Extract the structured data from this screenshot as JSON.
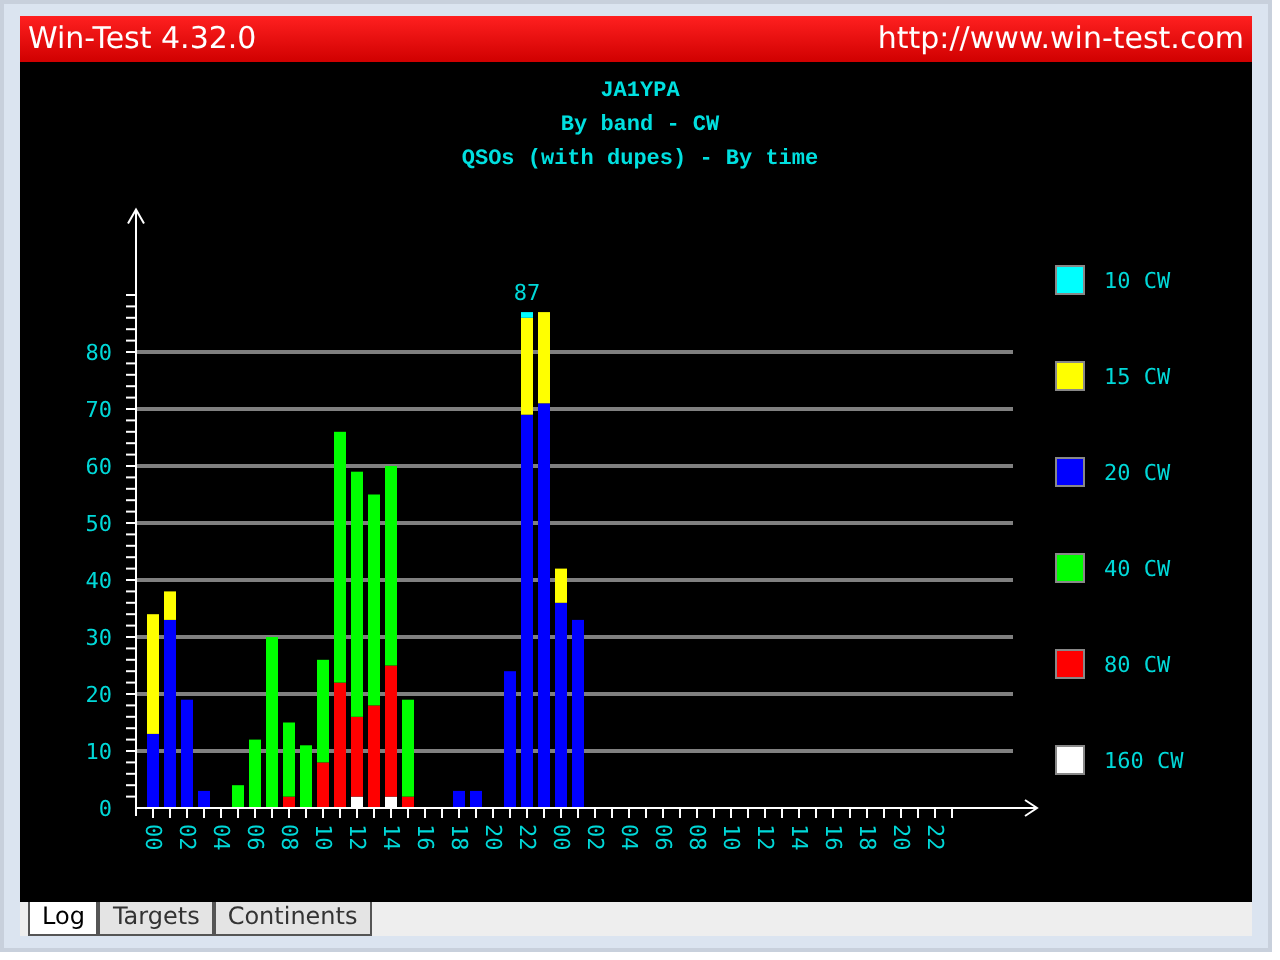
{
  "window": {
    "title": "Win-Test 4.32.0",
    "url": "http://www.win-test.com"
  },
  "chart": {
    "chart_data": {
      "type": "bar",
      "stacked": true,
      "title": [
        "JA1YPA",
        "By band - CW",
        "QSOs (with dupes) - By time"
      ],
      "x": [
        0,
        1,
        2,
        3,
        4,
        5,
        6,
        7,
        8,
        9,
        10,
        11,
        12,
        13,
        14,
        15,
        16,
        17,
        18,
        19,
        20,
        21,
        22,
        23,
        24,
        25,
        26,
        27,
        28,
        29,
        30,
        31,
        32,
        33,
        34,
        35,
        36,
        37,
        38,
        39,
        40,
        41,
        42,
        43,
        44,
        45,
        46,
        47
      ],
      "xlim": [
        -1,
        52
      ],
      "ylim": [
        0,
        105
      ],
      "grid": true,
      "legend": "right",
      "yticks": [
        0,
        10,
        20,
        30,
        40,
        50,
        60,
        70,
        80
      ],
      "xticks": [
        {
          "value": 0,
          "label": "00"
        },
        {
          "value": 2,
          "label": "02"
        },
        {
          "value": 4,
          "label": "04"
        },
        {
          "value": 6,
          "label": "06"
        },
        {
          "value": 8,
          "label": "08"
        },
        {
          "value": 10,
          "label": "10"
        },
        {
          "value": 12,
          "label": "12"
        },
        {
          "value": 14,
          "label": "14"
        },
        {
          "value": 16,
          "label": "16"
        },
        {
          "value": 18,
          "label": "18"
        },
        {
          "value": 20,
          "label": "20"
        },
        {
          "value": 22,
          "label": "22"
        },
        {
          "value": 24,
          "label": "00"
        },
        {
          "value": 26,
          "label": "02"
        },
        {
          "value": 28,
          "label": "04"
        },
        {
          "value": 30,
          "label": "06"
        },
        {
          "value": 32,
          "label": "08"
        },
        {
          "value": 34,
          "label": "10"
        },
        {
          "value": 36,
          "label": "12"
        },
        {
          "value": 38,
          "label": "14"
        },
        {
          "value": 40,
          "label": "16"
        },
        {
          "value": 42,
          "label": "18"
        },
        {
          "value": 44,
          "label": "20"
        },
        {
          "value": 46,
          "label": "22"
        }
      ],
      "annotations": [
        "87"
      ],
      "series": [
        {
          "name": "10 CW",
          "color": "#00ffff",
          "values": [
            0,
            0,
            0,
            0,
            0,
            0,
            0,
            0,
            0,
            0,
            0,
            0,
            0,
            0,
            0,
            0,
            0,
            0,
            0,
            0,
            0,
            0,
            1,
            0,
            0,
            0,
            0,
            0,
            0,
            0,
            0,
            0,
            0,
            0,
            0,
            0,
            0,
            0,
            0,
            0,
            0,
            0,
            0,
            0,
            0,
            0,
            0,
            0
          ]
        },
        {
          "name": "15 CW",
          "color": "#ffff00",
          "values": [
            21,
            5,
            0,
            0,
            0,
            0,
            0,
            0,
            0,
            0,
            0,
            0,
            0,
            0,
            0,
            0,
            0,
            0,
            0,
            0,
            0,
            0,
            17,
            16,
            6,
            0,
            0,
            0,
            0,
            0,
            0,
            0,
            0,
            0,
            0,
            0,
            0,
            0,
            0,
            0,
            0,
            0,
            0,
            0,
            0,
            0,
            0,
            0
          ]
        },
        {
          "name": "20 CW",
          "color": "#0000ff",
          "values": [
            13,
            33,
            19,
            3,
            0,
            0,
            0,
            0,
            0,
            0,
            0,
            0,
            0,
            0,
            0,
            0,
            0,
            0,
            3,
            3,
            0,
            24,
            69,
            71,
            36,
            33,
            0,
            0,
            0,
            0,
            0,
            0,
            0,
            0,
            0,
            0,
            0,
            0,
            0,
            0,
            0,
            0,
            0,
            0,
            0,
            0,
            0,
            0
          ]
        },
        {
          "name": "40 CW",
          "color": "#00ff00",
          "values": [
            0,
            0,
            0,
            0,
            0,
            4,
            12,
            30,
            13,
            11,
            18,
            44,
            43,
            37,
            35,
            17,
            0,
            0,
            0,
            0,
            0,
            0,
            0,
            0,
            0,
            0,
            0,
            0,
            0,
            0,
            0,
            0,
            0,
            0,
            0,
            0,
            0,
            0,
            0,
            0,
            0,
            0,
            0,
            0,
            0,
            0,
            0,
            0
          ]
        },
        {
          "name": "80 CW",
          "color": "#ff0000",
          "values": [
            0,
            0,
            0,
            0,
            0,
            0,
            0,
            0,
            2,
            0,
            8,
            22,
            14,
            18,
            23,
            2,
            0,
            0,
            0,
            0,
            0,
            0,
            0,
            0,
            0,
            0,
            0,
            0,
            0,
            0,
            0,
            0,
            0,
            0,
            0,
            0,
            0,
            0,
            0,
            0,
            0,
            0,
            0,
            0,
            0,
            0,
            0,
            0
          ]
        },
        {
          "name": "160 CW",
          "color": "#ffffff",
          "values": [
            0,
            0,
            0,
            0,
            0,
            0,
            0,
            0,
            0,
            0,
            0,
            0,
            2,
            0,
            2,
            0,
            0,
            0,
            0,
            0,
            0,
            0,
            0,
            0,
            0,
            0,
            0,
            0,
            0,
            0,
            0,
            0,
            0,
            0,
            0,
            0,
            0,
            0,
            0,
            0,
            0,
            0,
            0,
            0,
            0,
            0,
            0,
            0
          ]
        }
      ]
    }
  },
  "tabs": [
    {
      "label": "Log",
      "selected": true
    },
    {
      "label": "Targets",
      "selected": false
    },
    {
      "label": "Continents",
      "selected": false
    }
  ]
}
